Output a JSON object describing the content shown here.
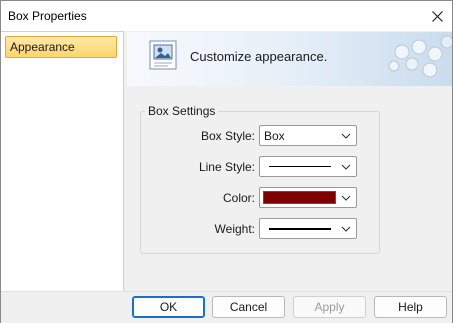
{
  "window": {
    "title": "Box Properties"
  },
  "sidebar": {
    "items": [
      {
        "label": "Appearance"
      }
    ]
  },
  "banner": {
    "text": "Customize appearance."
  },
  "box_settings": {
    "legend": "Box Settings",
    "box_style": {
      "label": "Box Style:",
      "value": "Box"
    },
    "line_style": {
      "label": "Line Style:"
    },
    "color": {
      "label": "Color:",
      "value_hex": "#7f0000"
    },
    "weight": {
      "label": "Weight:"
    }
  },
  "buttons": {
    "ok": "OK",
    "cancel": "Cancel",
    "apply": "Apply",
    "help": "Help"
  },
  "colors": {
    "selection_fill": "#fdd56c",
    "selection_border": "#e0a93a",
    "primary_border": "#1a6fc6"
  }
}
